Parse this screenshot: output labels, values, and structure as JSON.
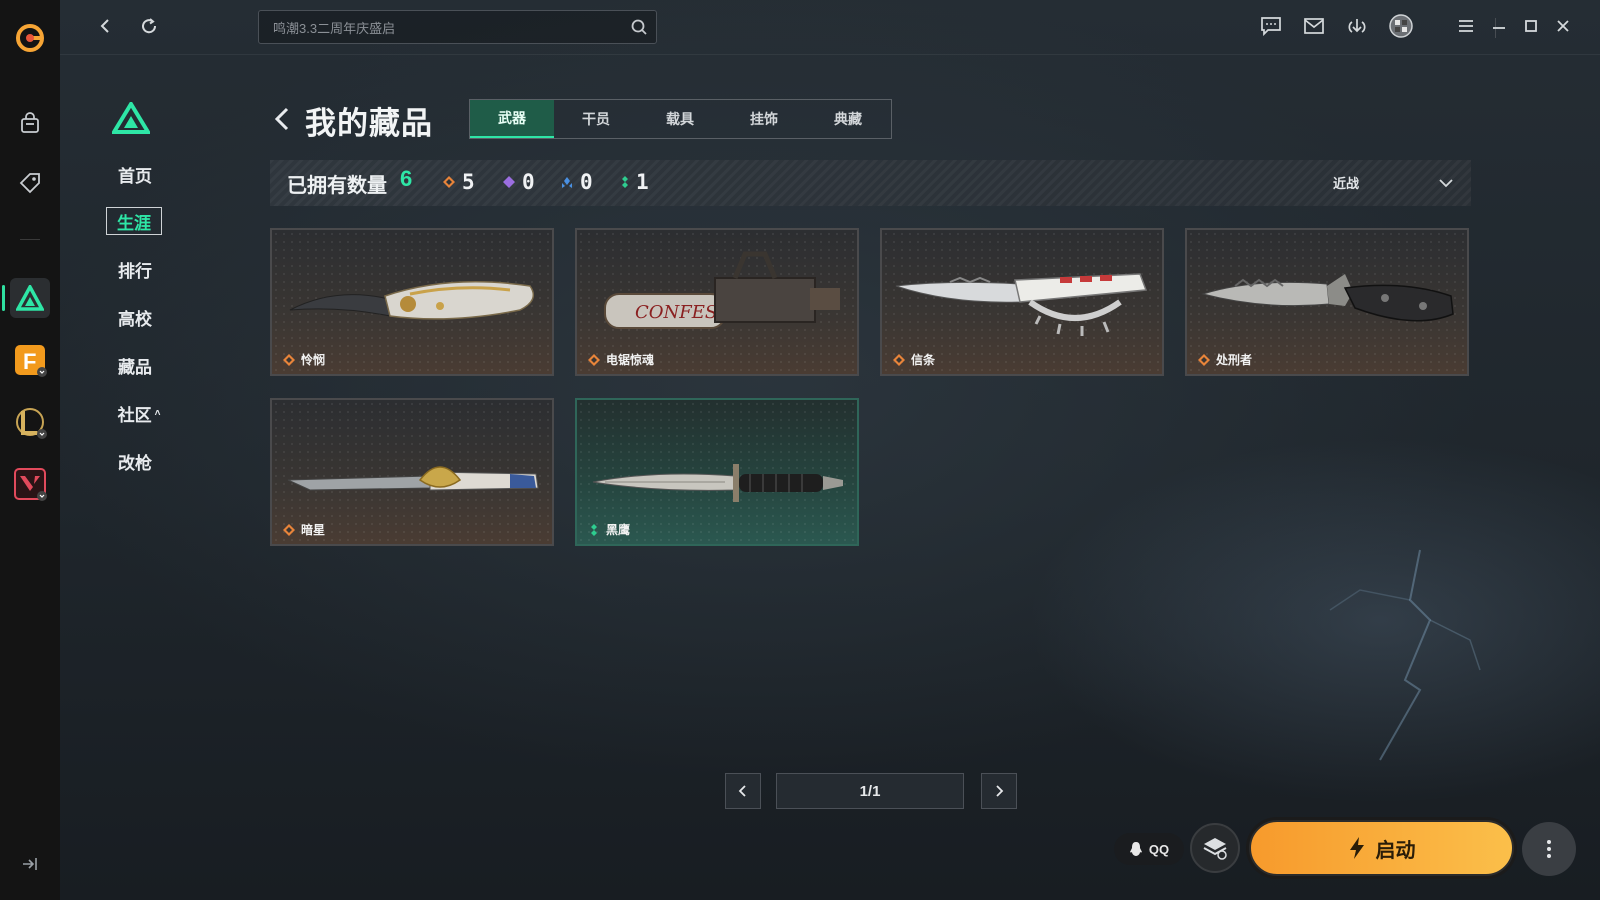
{
  "app": {
    "accent": "#2ee6a6",
    "brand_orange": "#f79a2c"
  },
  "rail": {
    "items": [
      {
        "name": "store-bag-icon"
      },
      {
        "name": "tag-icon"
      },
      {
        "name": "game-delta-icon"
      },
      {
        "name": "game-f-icon"
      },
      {
        "name": "game-league-icon"
      },
      {
        "name": "game-valorant-icon"
      }
    ]
  },
  "topbar": {
    "search_placeholder": "鸣潮3.3二周年庆盛启"
  },
  "nav": {
    "items": [
      {
        "label": "首页"
      },
      {
        "label": "生涯"
      },
      {
        "label": "排行"
      },
      {
        "label": "高校"
      },
      {
        "label": "藏品"
      },
      {
        "label": "社区"
      },
      {
        "label": "改枪"
      }
    ],
    "active": "生涯",
    "community_caret": "˄"
  },
  "page": {
    "title": "我的藏品",
    "tabs": [
      "武器",
      "干员",
      "载具",
      "挂饰",
      "典藏"
    ],
    "active_tab": "武器"
  },
  "stats": {
    "owned_label": "已拥有数量",
    "owned_count": "6",
    "rarity_counts": [
      {
        "color": "#e8843a",
        "count": "5"
      },
      {
        "color": "#9b6ee0",
        "count": "0"
      },
      {
        "color": "#4a90e2",
        "count": "0"
      },
      {
        "color": "#2ecc8f",
        "count": "1"
      }
    ],
    "filter_value": "近战"
  },
  "items": [
    {
      "name": "怜悯",
      "rarity": "orange"
    },
    {
      "name": "电锯惊魂",
      "rarity": "orange"
    },
    {
      "name": "信条",
      "rarity": "orange"
    },
    {
      "name": "处刑者",
      "rarity": "orange"
    },
    {
      "name": "暗星",
      "rarity": "orange"
    },
    {
      "name": "黑鹰",
      "rarity": "green"
    }
  ],
  "pagination": {
    "text": "1/1"
  },
  "actions": {
    "qq_label": "QQ",
    "launch_label": "启动"
  }
}
